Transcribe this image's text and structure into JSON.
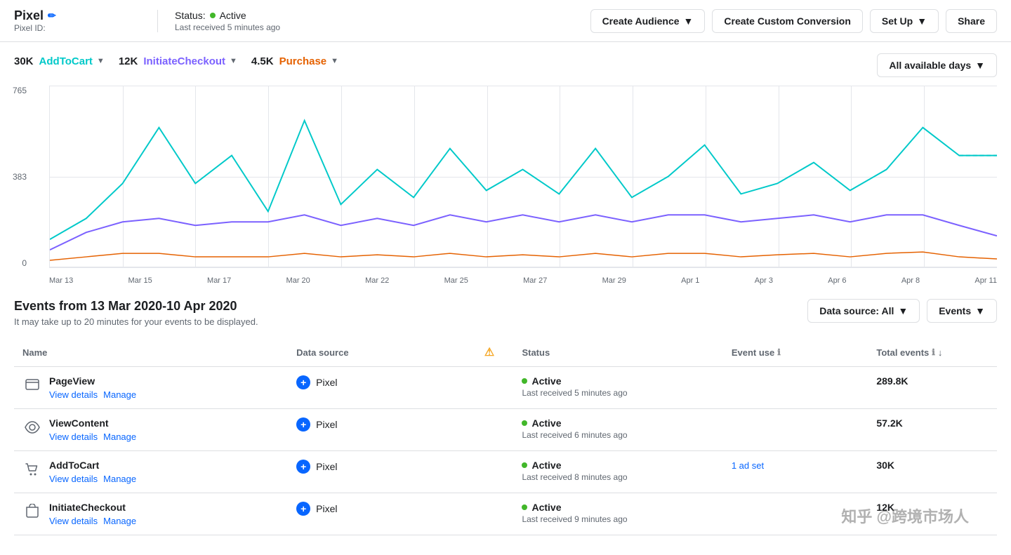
{
  "header": {
    "pixel_label": "Pixel",
    "edit_icon": "✏",
    "pixel_id_label": "Pixel ID:",
    "status_label": "Status:",
    "status_value": "Active",
    "last_received": "Last received 5 minutes ago",
    "btn_create_audience": "Create Audience",
    "btn_create_custom_conversion": "Create Custom Conversion",
    "btn_set_up": "Set Up",
    "btn_share": "Share"
  },
  "chart": {
    "legend": [
      {
        "count": "30K",
        "label": "AddToCart",
        "color": "#00c9c9",
        "class": "legend-label-addtocart"
      },
      {
        "count": "12K",
        "label": "InitiateCheckout",
        "color": "#7b61ff",
        "class": "legend-label-initiatecheckout"
      },
      {
        "count": "4.5K",
        "label": "Purchase",
        "color": "#e56100",
        "class": "legend-label-purchase"
      }
    ],
    "date_filter": "All available days",
    "y_labels": [
      "765",
      "383",
      "0"
    ],
    "x_labels": [
      "Mar 13",
      "Mar 15",
      "Mar 17",
      "Mar 20",
      "Mar 22",
      "Mar 25",
      "Mar 27",
      "Mar 29",
      "Apr 1",
      "Apr 3",
      "Apr 6",
      "Apr 8",
      "Apr 11"
    ]
  },
  "events": {
    "title": "Events from 13 Mar 2020-10 Apr 2020",
    "subtitle": "It may take up to 20 minutes for your events to be displayed.",
    "datasource_filter": "Data source: All",
    "events_filter": "Events",
    "table": {
      "headers": {
        "name": "Name",
        "data_source": "Data source",
        "warning": "⚠",
        "status": "Status",
        "event_use": "Event use",
        "total_events": "Total events",
        "info1": "ℹ",
        "info2": "ℹ",
        "sort": "↓"
      },
      "rows": [
        {
          "icon": "⬜",
          "icon_type": "pageview",
          "name": "PageView",
          "link1": "View details",
          "link2": "Manage",
          "datasource": "Pixel",
          "status": "Active",
          "status_time": "Last received 5 minutes ago",
          "event_use": "",
          "total_events": "289.8K"
        },
        {
          "icon": "👁",
          "icon_type": "viewcontent",
          "name": "ViewContent",
          "link1": "View details",
          "link2": "Manage",
          "datasource": "Pixel",
          "status": "Active",
          "status_time": "Last received 6 minutes ago",
          "event_use": "",
          "total_events": "57.2K"
        },
        {
          "icon": "🛒",
          "icon_type": "addtocart",
          "name": "AddToCart",
          "link1": "View details",
          "link2": "Manage",
          "datasource": "Pixel",
          "status": "Active",
          "status_time": "Last received 8 minutes ago",
          "event_use": "1 ad set",
          "total_events": "30K"
        },
        {
          "icon": "🛍",
          "icon_type": "initiatecheckout",
          "name": "InitiateCheckout",
          "link1": "View details",
          "link2": "Manage",
          "datasource": "Pixel",
          "status": "Active",
          "status_time": "Last received 9 minutes ago",
          "event_use": "",
          "total_events": "12K"
        }
      ]
    }
  },
  "watermark": "知乎 @跨境市场人"
}
